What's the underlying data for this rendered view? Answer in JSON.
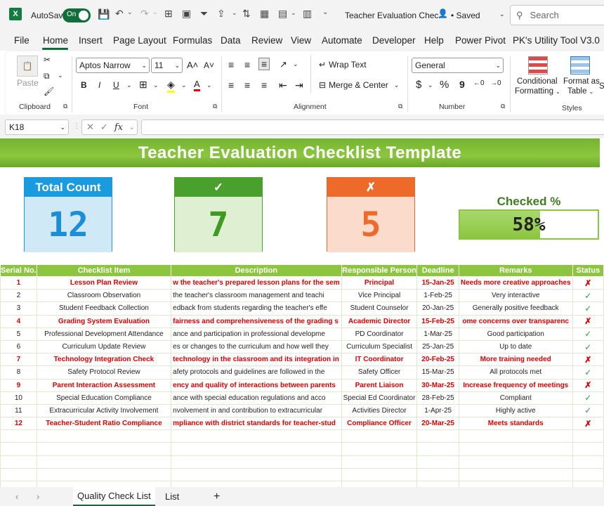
{
  "titlebar": {
    "autosave_label": "AutoSave",
    "autosave_state": "On",
    "file_title": "Teacher Evaluation Chec...",
    "saved_status": "• Saved",
    "search_placeholder": "Search"
  },
  "ribbon_tabs": [
    "File",
    "Home",
    "Insert",
    "Page Layout",
    "Formulas",
    "Data",
    "Review",
    "View",
    "Automate",
    "Developer",
    "Help",
    "Power Pivot",
    "PK's Utility Tool V3.0"
  ],
  "ribbon": {
    "clipboard": {
      "paste_label": "Paste",
      "group_label": "Clipboard"
    },
    "font": {
      "font_name": "Aptos Narrow",
      "font_size": "11",
      "bold": "B",
      "italic": "I",
      "underline": "U",
      "group_label": "Font"
    },
    "alignment": {
      "wrap_text": "Wrap Text",
      "merge_center": "Merge & Center",
      "group_label": "Alignment"
    },
    "number": {
      "format": "General",
      "currency": "$",
      "percent": "%",
      "comma": "9",
      "group_label": "Number"
    },
    "styles": {
      "conditional_line1": "Conditional",
      "conditional_line2": "Formatting",
      "format_table_line1": "Format as",
      "format_table_line2": "Table",
      "group_label": "Styles"
    }
  },
  "formula_bar": {
    "cell_ref": "K18",
    "fx": "fx",
    "value": ""
  },
  "sheet": {
    "banner_title": "Teacher Evaluation Checklist Template",
    "cards": [
      {
        "label": "Total Count",
        "value": "12",
        "head_color": "#1a9be0",
        "body_color": "#cfe9f7",
        "value_color": "#1a8fd8",
        "border": "#1a9be0"
      },
      {
        "label": "✓",
        "value": "7",
        "head_color": "#4aa02c",
        "body_color": "#dff0d2",
        "value_color": "#3e9a22",
        "border": "#4aa02c"
      },
      {
        "label": "✗",
        "value": "5",
        "head_color": "#ee6a2b",
        "body_color": "#fbdccc",
        "value_color": "#ee6a2b",
        "border": "#ee6a2b"
      }
    ],
    "checked_label": "Checked %",
    "checked_value": "58%",
    "checked_fraction": 0.58,
    "columns": [
      "Serial No.",
      "Checklist Item",
      "Description",
      "Responsible Person",
      "Deadline",
      "Remarks",
      "Status"
    ],
    "rows": [
      {
        "no": "1",
        "item": "Lesson Plan Review",
        "desc": "w the teacher's prepared lesson plans for the sem",
        "person": "Principal",
        "deadline": "15-Jan-25",
        "remarks": "Needs more creative approaches",
        "status": "✗"
      },
      {
        "no": "2",
        "item": "Classroom Observation",
        "desc": "the teacher's classroom management and teachi",
        "person": "Vice Principal",
        "deadline": "1-Feb-25",
        "remarks": "Very interactive",
        "status": "✓"
      },
      {
        "no": "3",
        "item": "Student Feedback Collection",
        "desc": "edback from students regarding the teacher's effe",
        "person": "Student Counselor",
        "deadline": "20-Jan-25",
        "remarks": "Generally positive feedback",
        "status": "✓"
      },
      {
        "no": "4",
        "item": "Grading System Evaluation",
        "desc": "fairness and comprehensiveness of the grading s",
        "person": "Academic Director",
        "deadline": "15-Feb-25",
        "remarks": "ome concerns over transparenc",
        "status": "✗"
      },
      {
        "no": "5",
        "item": "Professional Development Attendance",
        "desc": "ance and participation in professional developme",
        "person": "PD Coordinator",
        "deadline": "1-Mar-25",
        "remarks": "Good participation",
        "status": "✓"
      },
      {
        "no": "6",
        "item": "Curriculum Update Review",
        "desc": "es or changes to the curriculum and how well they",
        "person": "Curriculum Specialist",
        "deadline": "25-Jan-25",
        "remarks": "Up to date",
        "status": "✓"
      },
      {
        "no": "7",
        "item": "Technology Integration Check",
        "desc": "technology in the classroom and its integration in",
        "person": "IT Coordinator",
        "deadline": "20-Feb-25",
        "remarks": "More training needed",
        "status": "✗"
      },
      {
        "no": "8",
        "item": "Safety Protocol Review",
        "desc": "afety protocols and guidelines are followed in the",
        "person": "Safety Officer",
        "deadline": "15-Mar-25",
        "remarks": "All protocols met",
        "status": "✓"
      },
      {
        "no": "9",
        "item": "Parent Interaction Assessment",
        "desc": "ency and quality of interactions between parents",
        "person": "Parent Liaison",
        "deadline": "30-Mar-25",
        "remarks": "Increase frequency of meetings",
        "status": "✗"
      },
      {
        "no": "10",
        "item": "Special Education Compliance",
        "desc": "ance with special education regulations and acco",
        "person": "Special Ed Coordinator",
        "deadline": "28-Feb-25",
        "remarks": "Compliant",
        "status": "✓"
      },
      {
        "no": "11",
        "item": "Extracurricular Activity Involvement",
        "desc": "nvolvement in and contribution to extracurricular",
        "person": "Activities Director",
        "deadline": "1-Apr-25",
        "remarks": "Highly active",
        "status": "✓"
      },
      {
        "no": "12",
        "item": "Teacher-Student Ratio Compliance",
        "desc": "mpliance with district standards for teacher-stud",
        "person": "Compliance Officer",
        "deadline": "20-Mar-25",
        "remarks": "Meets standards",
        "status": "✗"
      }
    ]
  },
  "sheet_tabs": {
    "active": "Quality Check List",
    "other": "List",
    "add": "+"
  }
}
